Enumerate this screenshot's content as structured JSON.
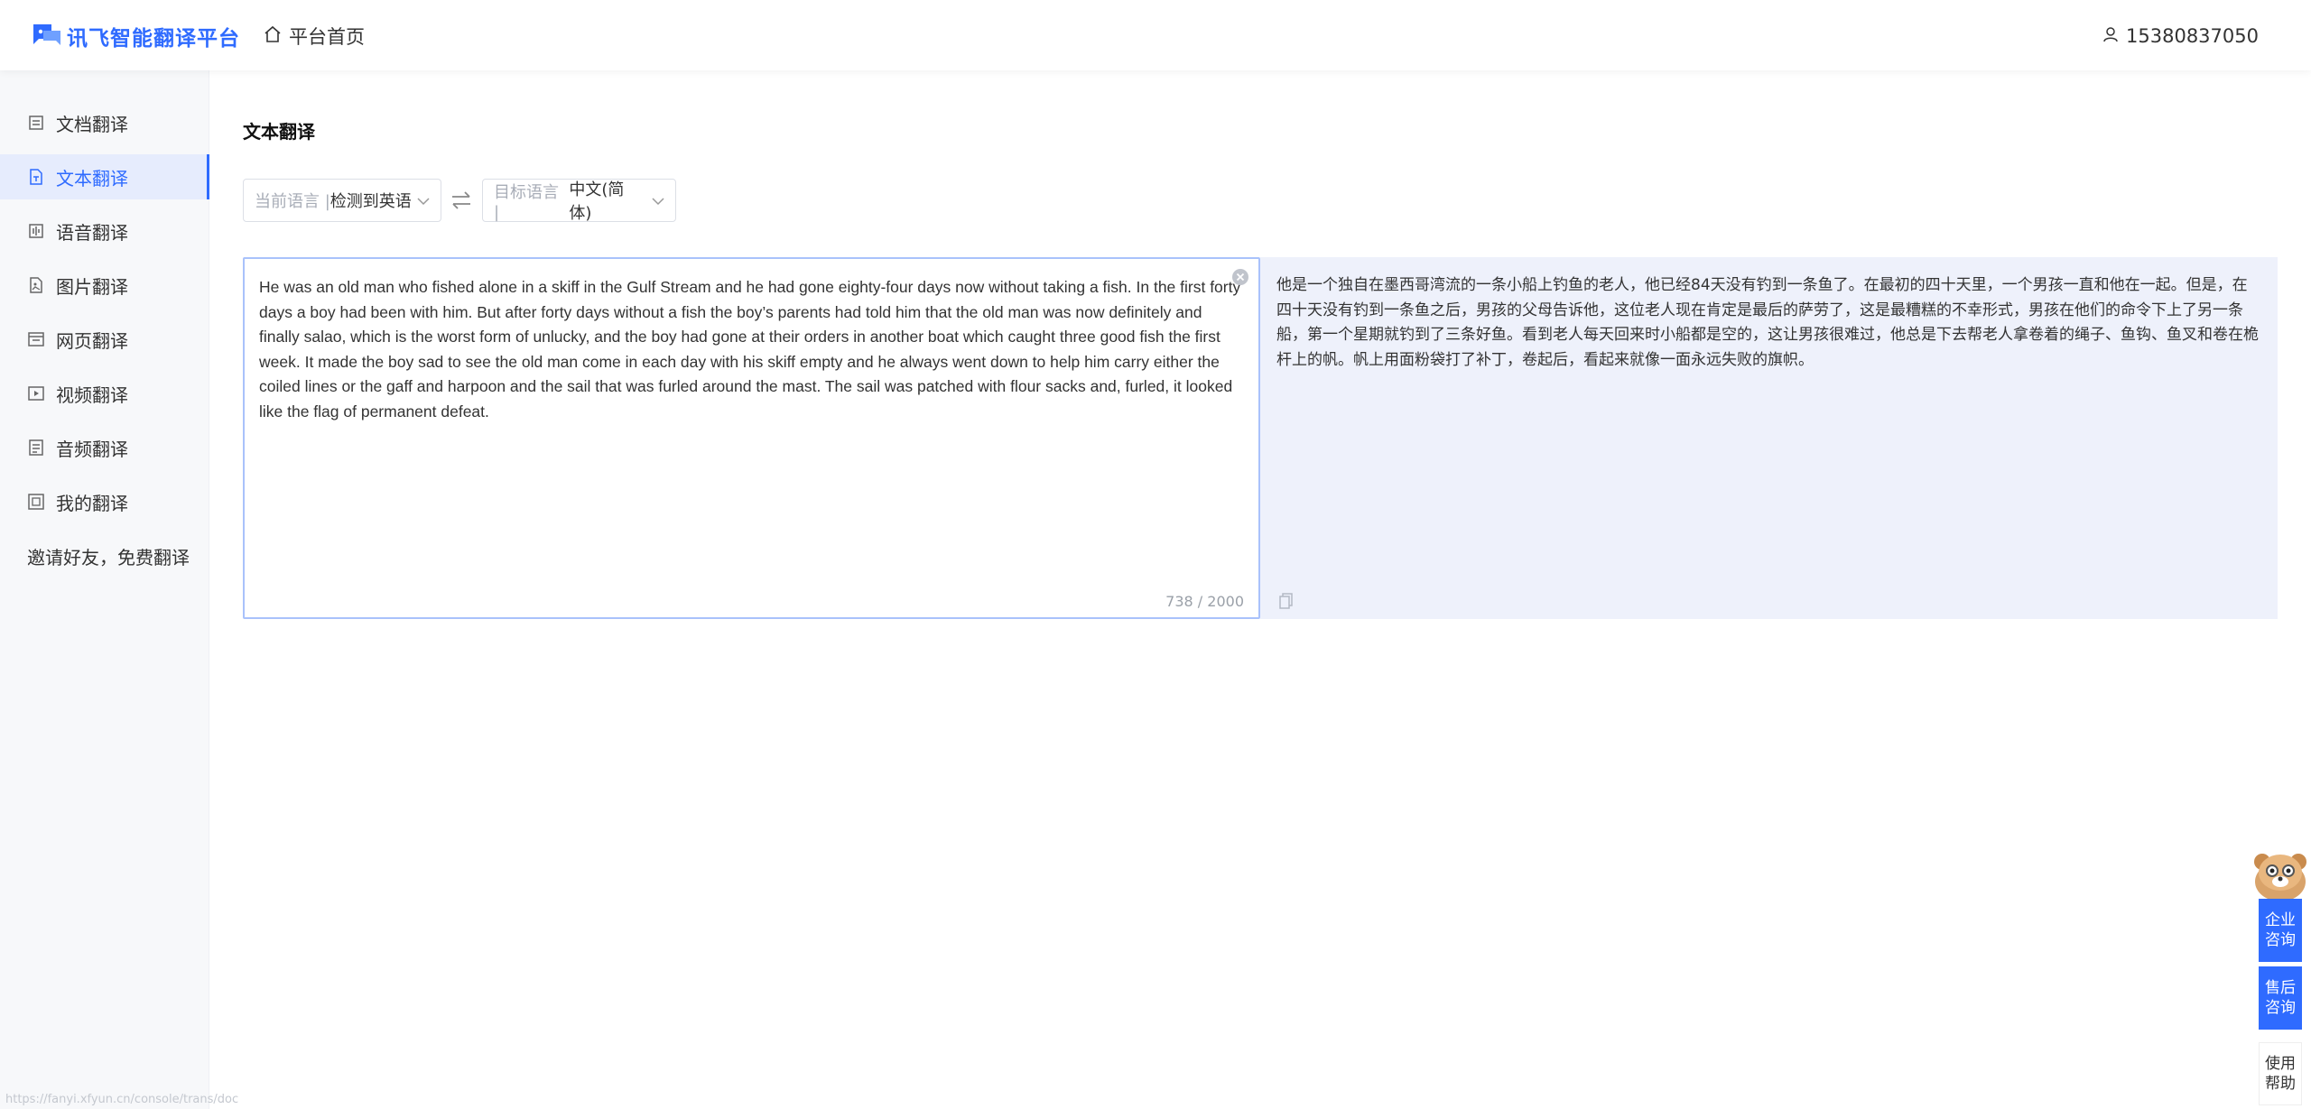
{
  "header": {
    "brand": "讯飞智能翻译平台",
    "home_label": "平台首页",
    "user_phone": "15380837050"
  },
  "sidebar": {
    "items": [
      {
        "label": "文档翻译",
        "icon": "document-icon"
      },
      {
        "label": "文本翻译",
        "icon": "text-file-icon",
        "active": true
      },
      {
        "label": "语音翻译",
        "icon": "voice-icon"
      },
      {
        "label": "图片翻译",
        "icon": "image-icon"
      },
      {
        "label": "网页翻译",
        "icon": "webpage-icon"
      },
      {
        "label": "视频翻译",
        "icon": "video-icon"
      },
      {
        "label": "音频翻译",
        "icon": "audio-icon"
      },
      {
        "label": "我的翻译",
        "icon": "my-translations-icon"
      }
    ],
    "invite": "邀请好友，免费翻译"
  },
  "main": {
    "title": "文本翻译",
    "source_lang": {
      "prefix": "当前语言 | ",
      "value": "检测到英语"
    },
    "target_lang": {
      "prefix": "目标语言 | ",
      "value": "中文(简体)"
    },
    "source_text": "He was an old man who fished alone in a skiff in the Gulf Stream and he had gone eighty-four days now without taking a fish. In the first forty days a boy had been with him. But after forty days without a fish the boy’s parents had told him that the old man was now definitely and finally salao, which is the worst form of unlucky, and the boy had gone at their orders in another boat which caught three good fish the first week. It made the boy sad to see the old man come in each day with his skiff empty and he always went down to help him carry either the coiled lines or the gaff and harpoon and the sail that was furled around the mast. The sail was patched with flour sacks and, furled, it looked like the flag of permanent defeat.",
    "char_count": "738 / 2000",
    "translated_text": "他是一个独自在墨西哥湾流的一条小船上钓鱼的老人，他已经84天没有钓到一条鱼了。在最初的四十天里，一个男孩一直和他在一起。但是，在四十天没有钓到一条鱼之后，男孩的父母告诉他，这位老人现在肯定是最后的萨劳了，这是最糟糕的不幸形式，男孩在他们的命令下上了另一条船，第一个星期就钓到了三条好鱼。看到老人每天回来时小船都是空的，这让男孩很难过，他总是下去帮老人拿卷着的绳子、鱼钩、鱼叉和卷在桅杆上的帆。帆上用面粉袋打了补丁，卷起后，看起来就像一面永远失败的旗帜。"
  },
  "float": {
    "enterprise": "企业咨询",
    "after_sales": "售后咨询",
    "help": "使用帮助"
  },
  "status_bar_url": "https://fanyi.xfyun.cn/console/trans/doc",
  "colors": {
    "accent": "#2f6bff",
    "active_bg": "#e6ecfd",
    "target_bg": "#eef1fb"
  }
}
